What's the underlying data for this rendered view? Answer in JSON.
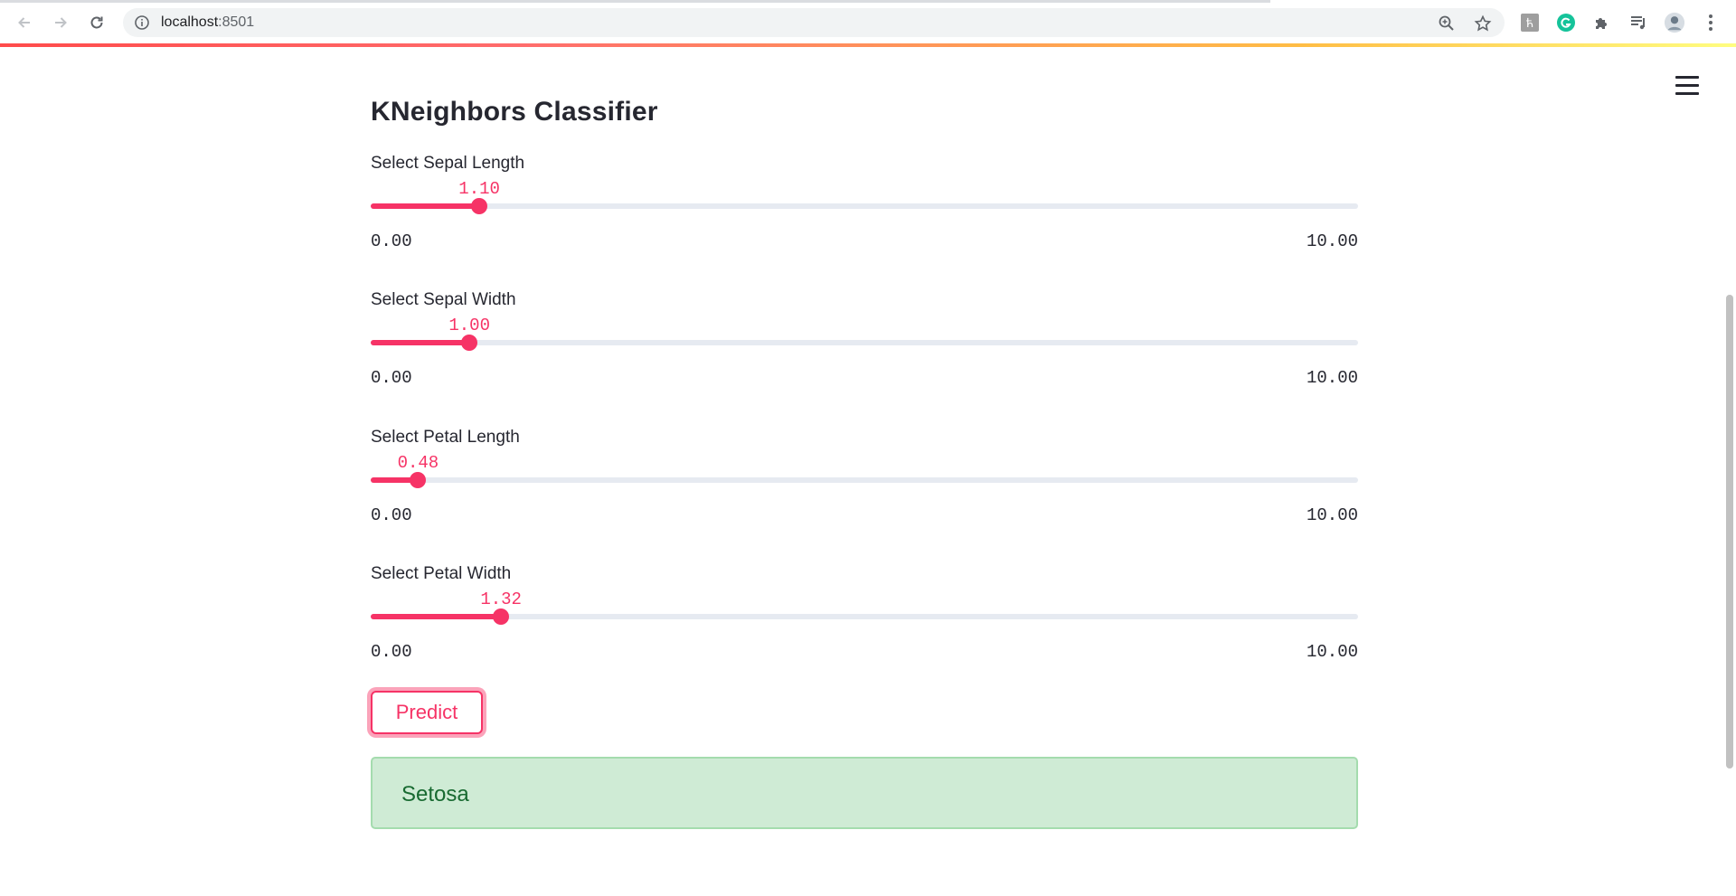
{
  "browser": {
    "url_host": "localhost",
    "url_port": ":8501",
    "icons": [
      "back-arrow-icon",
      "forward-arrow-icon",
      "reload-icon",
      "info-icon",
      "zoom-icon",
      "star-icon",
      "extension-h-icon",
      "grammarly-icon",
      "puzzle-icon",
      "media-queue-icon",
      "profile-avatar",
      "kebab-menu-icon"
    ]
  },
  "app": {
    "title": "KNeighbors Classifier",
    "accent_color": "#f63366",
    "menu_icon": "hamburger-icon"
  },
  "sliders": [
    {
      "label": "Select Sepal Length",
      "value": "1.10",
      "fraction": 0.11,
      "min": "0.00",
      "max": "10.00"
    },
    {
      "label": "Select Sepal Width",
      "value": "1.00",
      "fraction": 0.1,
      "min": "0.00",
      "max": "10.00"
    },
    {
      "label": "Select Petal Length",
      "value": "0.48",
      "fraction": 0.048,
      "min": "0.00",
      "max": "10.00"
    },
    {
      "label": "Select Petal Width",
      "value": "1.32",
      "fraction": 0.132,
      "min": "0.00",
      "max": "10.00"
    }
  ],
  "predict_button": {
    "label": "Predict"
  },
  "result": {
    "text": "Setosa",
    "background": "#cfebd5",
    "text_color": "#186a31"
  }
}
